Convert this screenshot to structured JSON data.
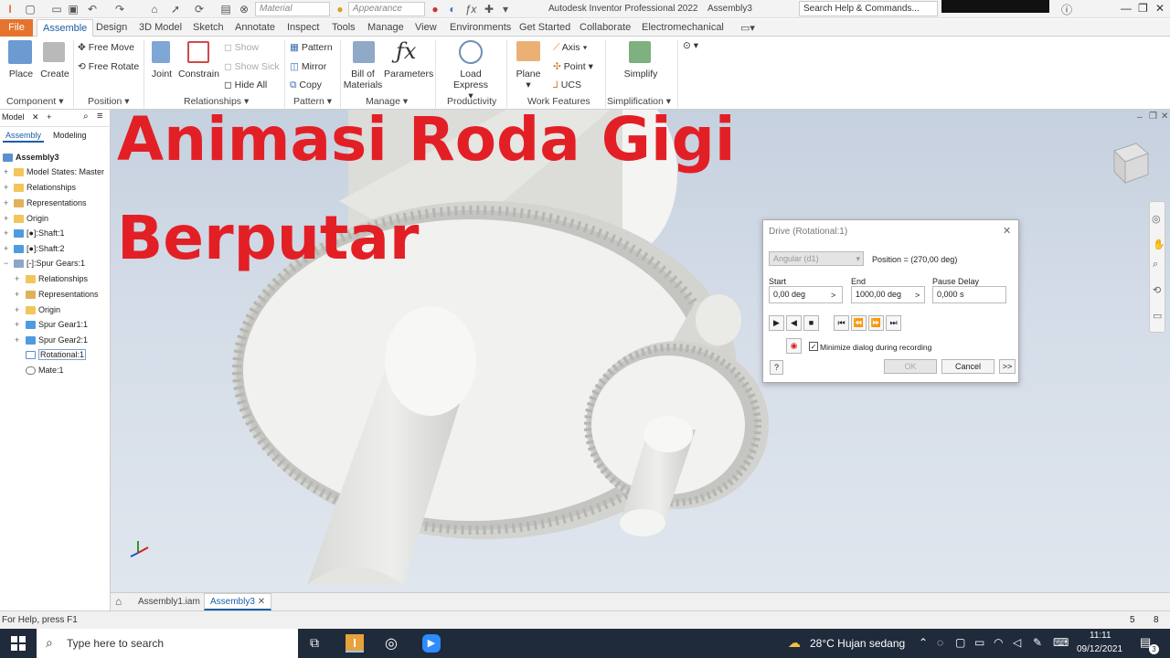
{
  "quick_access": {
    "material_placeholder": "Material",
    "appearance_placeholder": "Appearance"
  },
  "window": {
    "app_title": "Autodesk Inventor Professional 2022",
    "doc_title": "Assembly3",
    "search_placeholder": "Search Help & Commands..."
  },
  "tabs": [
    "File",
    "Assemble",
    "Design",
    "3D Model",
    "Sketch",
    "Annotate",
    "Inspect",
    "Tools",
    "Manage",
    "View",
    "Environments",
    "Get Started",
    "Collaborate",
    "Electromechanical"
  ],
  "ribbon": {
    "place": "Place",
    "create": "Create",
    "free_move": "Free Move",
    "free_rotate": "Free Rotate",
    "joint": "Joint",
    "constrain": "Constrain",
    "show": "Show",
    "show_sick": "Show Sick",
    "hide_all": "Hide All",
    "pattern": "Pattern",
    "mirror": "Mirror",
    "copy": "Copy",
    "bill_of_materials_1": "Bill of",
    "bill_of_materials_2": "Materials",
    "parameters": "Parameters",
    "load_express": "Load Express",
    "plane": "Plane",
    "axis": "Axis",
    "point": "Point",
    "ucs": "UCS",
    "simplify": "Simplify",
    "groups": {
      "component": "Component",
      "position": "Position",
      "relationships": "Relationships",
      "pattern": "Pattern",
      "manage": "Manage",
      "productivity": "Productivity",
      "work_features": "Work Features",
      "simplification": "Simplification"
    }
  },
  "browser": {
    "header": "Model",
    "tab_assembly": "Assembly",
    "tab_modeling": "Modeling",
    "items": [
      {
        "label": "Assembly3"
      },
      {
        "label": "Model States: Master"
      },
      {
        "label": "Relationships"
      },
      {
        "label": "Representations"
      },
      {
        "label": "Origin"
      },
      {
        "label": "[●]:Shaft:1"
      },
      {
        "label": "[●]:Shaft:2"
      },
      {
        "label": "[-]:Spur Gears:1"
      },
      {
        "label": "Relationships"
      },
      {
        "label": "Representations"
      },
      {
        "label": "Origin"
      },
      {
        "label": "Spur Gear1:1"
      },
      {
        "label": "Spur Gear2:1"
      },
      {
        "label": "Rotational:1"
      },
      {
        "label": "Mate:1"
      }
    ]
  },
  "overlay": {
    "line1": "Animasi Roda Gigi",
    "line2": "Berputar"
  },
  "dialog": {
    "title": "Drive (Rotational:1)",
    "mode": "Angular (d1)",
    "position": "Position = (270,00 deg)",
    "start_label": "Start",
    "start_value": "0,00 deg",
    "end_label": "End",
    "end_value": "1000,00 deg",
    "pause_label": "Pause Delay",
    "pause_value": "0,000 s",
    "minimize_label": "Minimize dialog during recording",
    "ok": "OK",
    "cancel": "Cancel",
    "more": ">>"
  },
  "doc_tabs": {
    "tab1": "Assembly1.iam",
    "tab2": "Assembly3"
  },
  "status": {
    "help": "For Help, press F1",
    "count1": "5",
    "count2": "8"
  },
  "taskbar": {
    "search_placeholder": "Type here to search",
    "weather": "28°C  Hujan sedang",
    "time": "11:11",
    "date": "09/12/2021",
    "notifications": "3"
  }
}
